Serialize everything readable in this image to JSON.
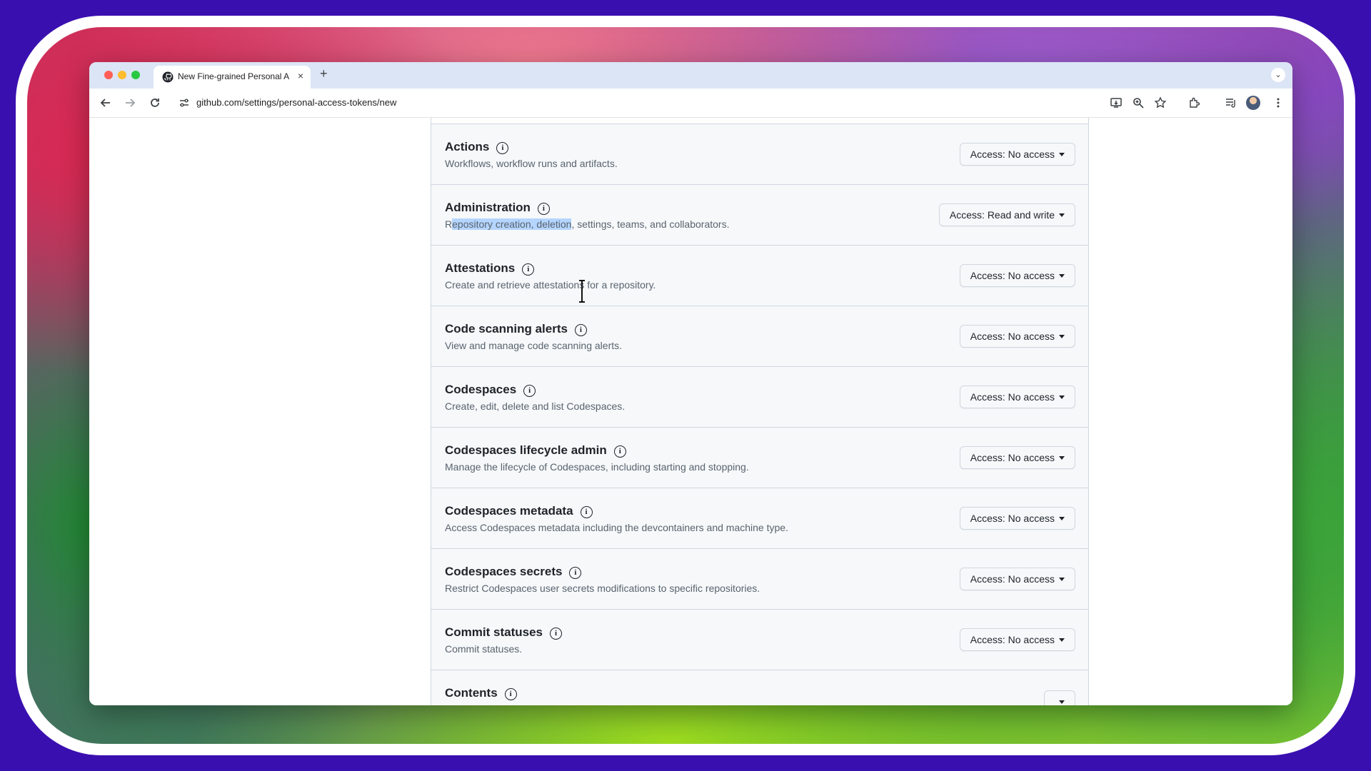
{
  "browser": {
    "tab_title": "New Fine-grained Personal A",
    "url": "github.com/settings/personal-access-tokens/new",
    "new_tab_symbol": "+",
    "close_symbol": "×",
    "tab_menu_symbol": "⌄"
  },
  "permissions": [
    {
      "name": "Actions",
      "description": "Workflows, workflow runs and artifacts.",
      "access": "Access: No access"
    },
    {
      "name": "Administration",
      "description": "Repository creation, deletion, settings, teams, and collaborators.",
      "description_prefix": "R",
      "description_selected": "epository creation, deletion",
      "description_rest": ", settings, teams, and collaborators.",
      "access": "Access: Read and write"
    },
    {
      "name": "Attestations",
      "description": "Create and retrieve attestations for a repository.",
      "access": "Access: No access"
    },
    {
      "name": "Code scanning alerts",
      "description": "View and manage code scanning alerts.",
      "access": "Access: No access"
    },
    {
      "name": "Codespaces",
      "description": "Create, edit, delete and list Codespaces.",
      "access": "Access: No access"
    },
    {
      "name": "Codespaces lifecycle admin",
      "description": "Manage the lifecycle of Codespaces, including starting and stopping.",
      "access": "Access: No access"
    },
    {
      "name": "Codespaces metadata",
      "description": "Access Codespaces metadata including the devcontainers and machine type.",
      "access": "Access: No access"
    },
    {
      "name": "Codespaces secrets",
      "description": "Restrict Codespaces user secrets modifications to specific repositories.",
      "access": "Access: No access"
    },
    {
      "name": "Commit statuses",
      "description": "Commit statuses.",
      "access": "Access: No access"
    },
    {
      "name": "Contents"
    }
  ],
  "icons": {
    "info": "info-circle-icon",
    "nav": [
      "back-arrow-icon",
      "forward-arrow-icon",
      "reload-icon",
      "site-settings-icon"
    ],
    "toolbar": [
      "install-app-icon",
      "zoom-icon",
      "bookmark-star-icon",
      "extensions-icon",
      "media-control-icon",
      "profile-avatar",
      "more-menu-icon"
    ]
  },
  "colors": {
    "selection": "#b4d5fe",
    "panel_bg": "#f6f8fa",
    "border": "#d0d7de",
    "text": "#1f2328",
    "muted": "#59636e"
  }
}
